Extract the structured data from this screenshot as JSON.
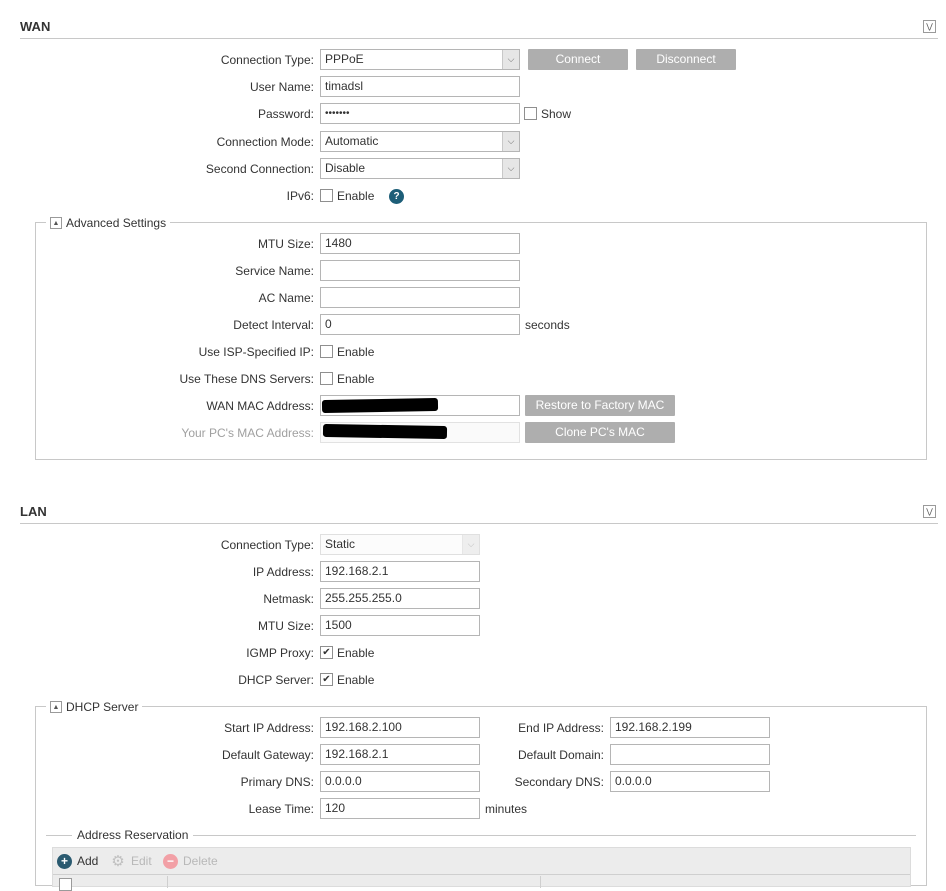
{
  "wan": {
    "title": "WAN",
    "connection_type": {
      "label": "Connection Type:",
      "value": "PPPoE"
    },
    "connect_label": "Connect",
    "disconnect_label": "Disconnect",
    "user_name": {
      "label": "User Name:",
      "value": "timadsl"
    },
    "password": {
      "label": "Password:",
      "value": "•••••••",
      "show_label": "Show"
    },
    "connection_mode": {
      "label": "Connection Mode:",
      "value": "Automatic"
    },
    "second_connection": {
      "label": "Second Connection:",
      "value": "Disable"
    },
    "ipv6": {
      "label": "IPv6:",
      "enable_label": "Enable"
    },
    "help_glyph": "?",
    "advanced": {
      "legend": "Advanced Settings",
      "mtu_size": {
        "label": "MTU Size:",
        "value": "1480"
      },
      "service_name": {
        "label": "Service Name:",
        "value": ""
      },
      "ac_name": {
        "label": "AC Name:",
        "value": ""
      },
      "detect_interval": {
        "label": "Detect Interval:",
        "value": "0",
        "unit": "seconds"
      },
      "isp_ip": {
        "label": "Use ISP-Specified IP:",
        "enable_label": "Enable"
      },
      "dns_servers": {
        "label": "Use These DNS Servers:",
        "enable_label": "Enable"
      },
      "wan_mac": {
        "label": "WAN MAC Address:",
        "button": "Restore to Factory MAC"
      },
      "pc_mac": {
        "label": "Your PC's MAC Address:",
        "button": "Clone PC's MAC"
      }
    }
  },
  "lan": {
    "title": "LAN",
    "connection_type": {
      "label": "Connection Type:",
      "value": "Static"
    },
    "ip_address": {
      "label": "IP Address:",
      "value": "192.168.2.1"
    },
    "netmask": {
      "label": "Netmask:",
      "value": "255.255.255.0"
    },
    "mtu_size": {
      "label": "MTU Size:",
      "value": "1500"
    },
    "igmp_proxy": {
      "label": "IGMP Proxy:",
      "enable_label": "Enable",
      "checked": true
    },
    "dhcp_server": {
      "label": "DHCP Server:",
      "enable_label": "Enable",
      "checked": true
    },
    "dhcp": {
      "legend": "DHCP Server",
      "start_ip": {
        "label": "Start IP Address:",
        "value": "192.168.2.100"
      },
      "end_ip": {
        "label": "End IP Address:",
        "value": "192.168.2.199"
      },
      "default_gateway": {
        "label": "Default Gateway:",
        "value": "192.168.2.1"
      },
      "default_domain": {
        "label": "Default Domain:",
        "value": ""
      },
      "primary_dns": {
        "label": "Primary DNS:",
        "value": "0.0.0.0"
      },
      "secondary_dns": {
        "label": "Secondary DNS:",
        "value": "0.0.0.0"
      },
      "lease_time": {
        "label": "Lease Time:",
        "value": "120",
        "unit": "minutes"
      }
    },
    "reservation": {
      "legend": "Address Reservation",
      "add_label": "Add",
      "edit_label": "Edit",
      "delete_label": "Delete"
    }
  },
  "colors": {
    "button_grey": "#aeaeae",
    "help_icon": "#1d5e78",
    "add_icon": "#2a5a70",
    "delete_icon": "#f2a0a6"
  }
}
